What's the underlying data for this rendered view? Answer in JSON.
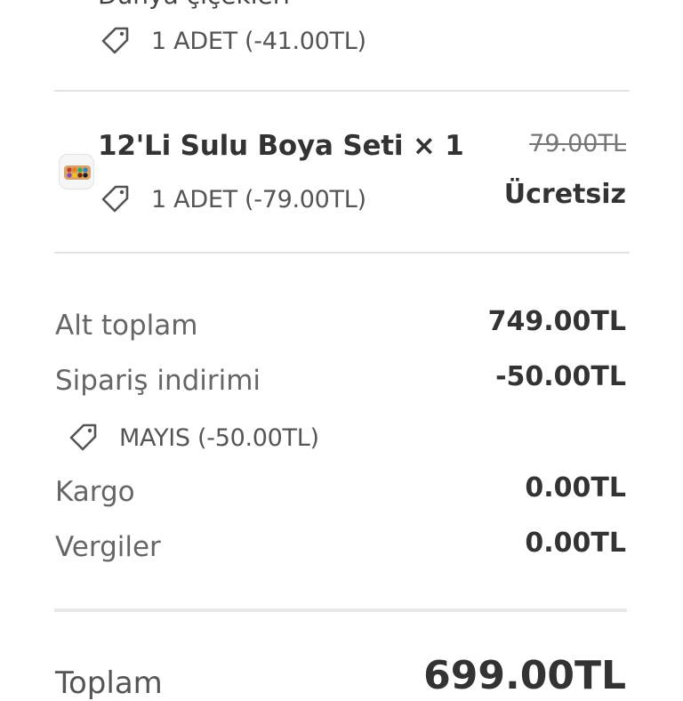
{
  "previous_item": {
    "title_cut": "Dünya çiçekleri",
    "discount_text": "1 ADET (-41.00TL)",
    "icon": "tag-icon"
  },
  "item": {
    "title": "12'Li Sulu Boya Seti × 1",
    "original_price": "79.00TL",
    "final_price": "Ücretsiz",
    "discount_text": "1 ADET (-79.00TL)",
    "icon": "tag-icon"
  },
  "summary": {
    "subtotal_label": "Alt toplam",
    "subtotal_value": "749.00TL",
    "order_discount_label": "Sipariş indirimi",
    "order_discount_value": "-50.00TL",
    "coupon_text": "MAYIS (-50.00TL)",
    "shipping_label": "Kargo",
    "shipping_value": "0.00TL",
    "tax_label": "Vergiler",
    "tax_value": "0.00TL"
  },
  "total": {
    "label": "Toplam",
    "value": "699.00TL"
  }
}
